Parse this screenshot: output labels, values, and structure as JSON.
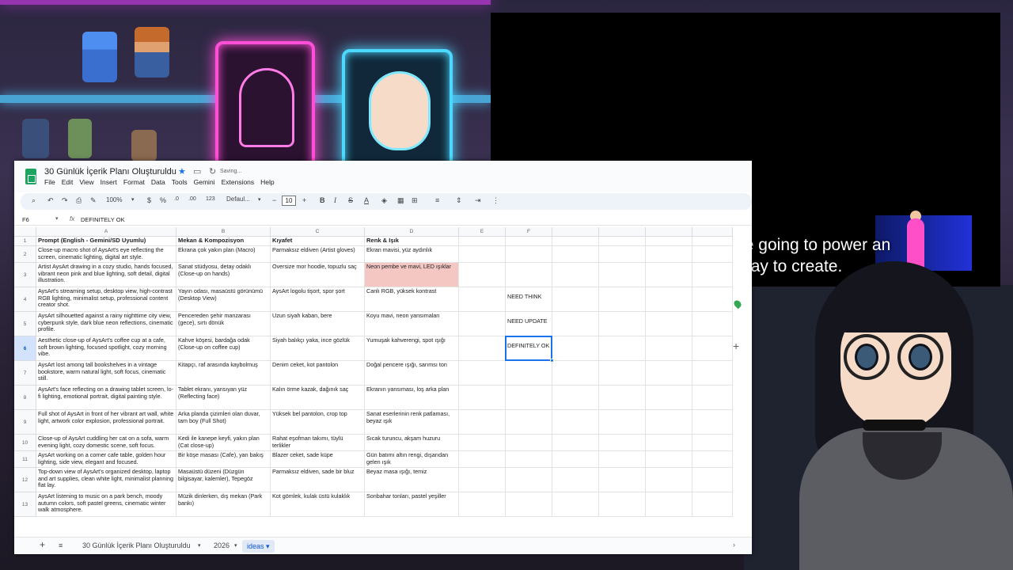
{
  "video": {
    "caption_line1": "But tomorrow, they're going to power an",
    "caption_line2": "entirely new way to create."
  },
  "sheets": {
    "title": "30 Günlük İçerik Planı Oluşturuldu",
    "status": "Saving...",
    "menu": [
      "File",
      "Edit",
      "View",
      "Insert",
      "Format",
      "Data",
      "Tools",
      "Gemini",
      "Extensions",
      "Help"
    ],
    "toolbar": {
      "zoom": "100%",
      "currency": "$",
      "percent": "%",
      "dec_decrease": ".0",
      "dec_increase": ".00",
      "number_format": "123",
      "font": "Defaul...",
      "font_size": "10"
    },
    "namebox": "F6",
    "formula": "DEFINITELY OK",
    "columns": [
      "A",
      "B",
      "C",
      "D",
      "E",
      "F"
    ],
    "rows": [
      {
        "num": "1",
        "a": "Prompt (English - Gemini/SD Uyumlu)",
        "b": "Mekan & Kompozisyon",
        "c": "Kıyafet",
        "d": "Renk & Işık",
        "f": ""
      },
      {
        "num": "2",
        "a": "Close-up macro shot of AysArt's eye reflecting the screen, cinematic lighting, digital art style.",
        "b": "Ekrana çok yakın plan (Macro)",
        "c": "Parmaksız eldiven (Artist gloves)",
        "d": "Ekran mavisi, yüz aydınlık",
        "f": ""
      },
      {
        "num": "3",
        "a": "Artist AysArt drawing in a cozy studio, hands focused, vibrant neon pink and blue lighting, soft detail, digital illustration.",
        "b": "Sanat stüdyosu, detay odaklı (Close-up on hands)",
        "c": "Oversize mor hoodie, topuzlu saç",
        "d": "Neon pembe ve mavi, LED ışıklar",
        "f": ""
      },
      {
        "num": "4",
        "a": "AysArt's streaming setup, desktop view, high-contrast RGB lighting, minimalist setup, professional content creator shot.",
        "b": "Yayın odası, masaüstü görünümü (Desktop View)",
        "c": "AysArt logolu tişort, spor şort",
        "d": "Canlı RGB, yüksek kontrast",
        "f": "NEED THINK"
      },
      {
        "num": "5",
        "a": "AysArt silhouetted against a rainy nighttime city view, cyberpunk style, dark blue neon reflections, cinematic profile.",
        "b": "Pencereden şehir manzarası (gece), sırtı dönük",
        "c": "Uzun siyah kaban, bere",
        "d": "Koyu mavi, neon yansımaları",
        "f": "NEED UPDATE"
      },
      {
        "num": "6",
        "a": "Aesthetic close-up of AysArt's coffee cup at a cafe, soft brown lighting, focused spotlight, cozy morning vibe.",
        "b": "Kahve köşesi, bardağa odak (Close-up on coffee cup)",
        "c": "Siyah balıkçı yaka, ince gözlük",
        "d": "Yumuşak kahverengi, spot ışığı",
        "f": "DEFINITELY OK"
      },
      {
        "num": "7",
        "a": "AysArt lost among tall bookshelves in a vintage bookstore, warm natural light, soft focus, cinematic still.",
        "b": "Kitapçı, raf arasında kaybolmuş",
        "c": "Denim ceket, kot pantolon",
        "d": "Doğal pencere ışığı, sarımsı ton",
        "f": ""
      },
      {
        "num": "8",
        "a": "AysArt's face reflecting on a drawing tablet screen, lo-fi lighting, emotional portrait, digital painting style.",
        "b": "Tablet ekranı, yansıyan yüz (Reflecting face)",
        "c": "Kalın örme kazak, dağınık saç",
        "d": "Ekranın yansıması, loş arka plan",
        "f": ""
      },
      {
        "num": "9",
        "a": "Full shot of AysArt in front of her vibrant art wall, white light, artwork color explosion, professional portrait.",
        "b": "Arka planda çizimleri olan duvar, tam boy (Full Shot)",
        "c": "Yüksek bel pantolon, crop top",
        "d": "Sanat eserlerinin renk patlaması, beyaz ışık",
        "f": ""
      },
      {
        "num": "10",
        "a": "Close-up of AysArt cuddling her cat on a sofa, warm evening light, cozy domestic scene, soft focus.",
        "b": "Kedi ile kanepe keyfi, yakın plan (Cat close-up)",
        "c": "Rahat eşofman takımı, tüylü terlikler",
        "d": "Sıcak turuncu, akşam huzuru",
        "f": ""
      },
      {
        "num": "11",
        "a": "AysArt working on a corner cafe table, golden hour lighting, side view, elegant and focused.",
        "b": "Bir köşe masası (Cafe), yan bakış",
        "c": "Blazer ceket, sade küpe",
        "d": "Gün batımı altın rengi, dışarıdan gelen ışık",
        "f": ""
      },
      {
        "num": "12",
        "a": "Top-down view of AysArt's organized desktop, laptop and art supplies, clean white light, minimalist planning flat lay.",
        "b": "Masaüstü düzeni (Düzgün bilgisayar, kalemler), Tepegöz",
        "c": "Parmaksız eldiven, sade bir bluz",
        "d": "Beyaz masa ışığı, temiz",
        "f": ""
      },
      {
        "num": "13",
        "a": "AysArt listening to music on a park bench, moody autumn colors, soft pastel greens, cinematic winter walk atmosphere.",
        "b": "Müzik dinlerken, dış mekan (Park bankı)",
        "c": "Kot gömlek, kulak üstü kulaklık",
        "d": "Sonbahar tonları, pastel yeşiller",
        "f": ""
      }
    ],
    "tabs": {
      "tab1": "30 Günlük İçerik Planı Oluşturuldu",
      "tab2": "2026",
      "tab3": "ideas"
    },
    "colors": {
      "brand": "#1ea362",
      "highlight": "#f4c7c3",
      "selection": "#1a73e8"
    }
  }
}
